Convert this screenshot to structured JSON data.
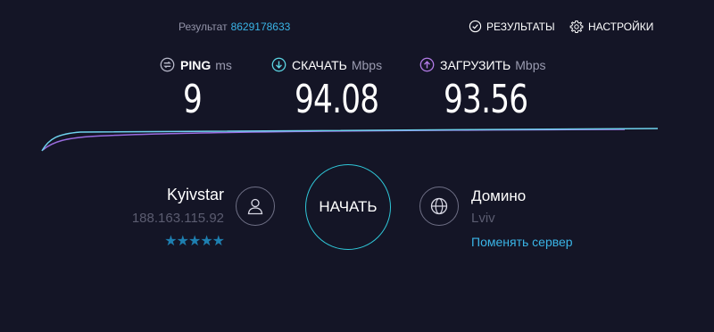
{
  "header": {
    "result_label": "Результат",
    "result_id": "8629178633",
    "results_link": "РЕЗУЛЬТАТЫ",
    "settings_link": "НАСТРОЙКИ"
  },
  "metrics": {
    "ping": {
      "label": "PING",
      "unit": "ms",
      "value": "9"
    },
    "download": {
      "label": "СКАЧАТЬ",
      "unit": "Mbps",
      "value": "94.08"
    },
    "upload": {
      "label": "ЗАГРУЗИТЬ",
      "unit": "Mbps",
      "value": "93.56"
    }
  },
  "graph": {
    "download_color": "#6fd3ee",
    "upload_color": "#9a6ce0"
  },
  "provider": {
    "name": "Kyivstar",
    "ip": "188.163.115.92",
    "stars": "★★★★★",
    "star_count": 5
  },
  "go_button": {
    "label": "НАЧАТЬ"
  },
  "server": {
    "name": "Домино",
    "location": "Lviv",
    "change_label": "Поменять сервер"
  },
  "colors": {
    "background": "#141526",
    "accent": "#3ab4e6",
    "button_ring": "#2fc7d8"
  }
}
